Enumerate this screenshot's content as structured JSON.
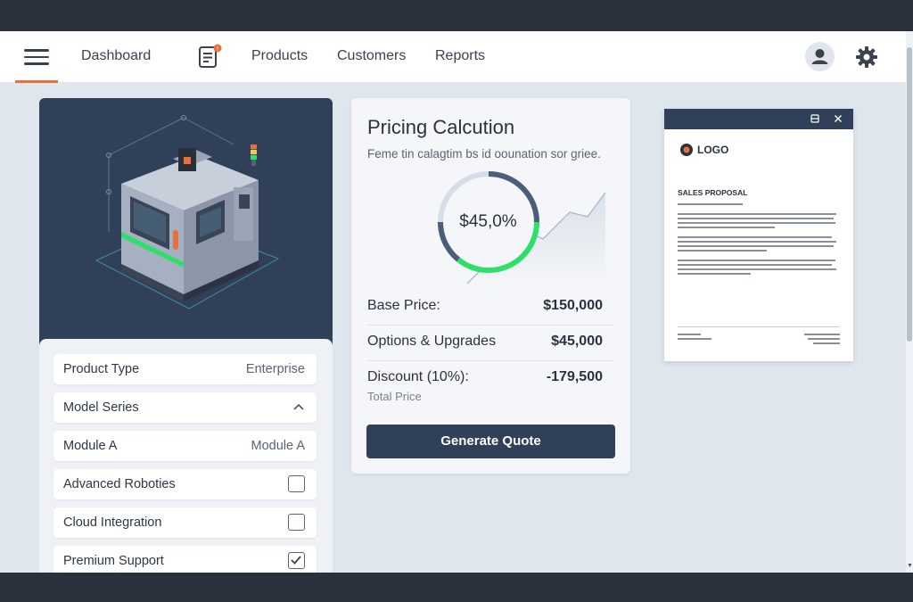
{
  "nav": {
    "dashboard": "Dashboard",
    "products": "Products",
    "customers": "Customers",
    "reports": "Reports",
    "accent_color": "#e8703a"
  },
  "options": [
    {
      "label": "Product Type",
      "value": "Enterprise",
      "control": "value"
    },
    {
      "label": "Model Series",
      "value": "",
      "control": "chevron-up"
    },
    {
      "label": "Module A",
      "value": "Module A",
      "control": "value"
    },
    {
      "label": "Advanced Roboties",
      "checked": false,
      "control": "checkbox"
    },
    {
      "label": "Cloud Integration",
      "checked": false,
      "control": "checkbox"
    },
    {
      "label": "Premium Support",
      "checked": true,
      "control": "checkbox"
    }
  ],
  "pricing": {
    "title": "Pricing Calcution",
    "subtitle": "Feme tin calagtim bs id oounation sor griee.",
    "gauge_value": "$45,0%",
    "rows": [
      {
        "label": "Base Price:",
        "value": "$150,000"
      },
      {
        "label": "Options & Upgrades",
        "value": "$45,000"
      },
      {
        "label": "Discount (10%):",
        "value": "-179,500"
      }
    ],
    "total_label": "Total Price",
    "button": "Generate Quote",
    "brand_color": "#2f4058",
    "gauge_color": "#2ee06a"
  },
  "doc": {
    "logo_text": "LOGO",
    "title": "SALES PROPOSAL"
  }
}
